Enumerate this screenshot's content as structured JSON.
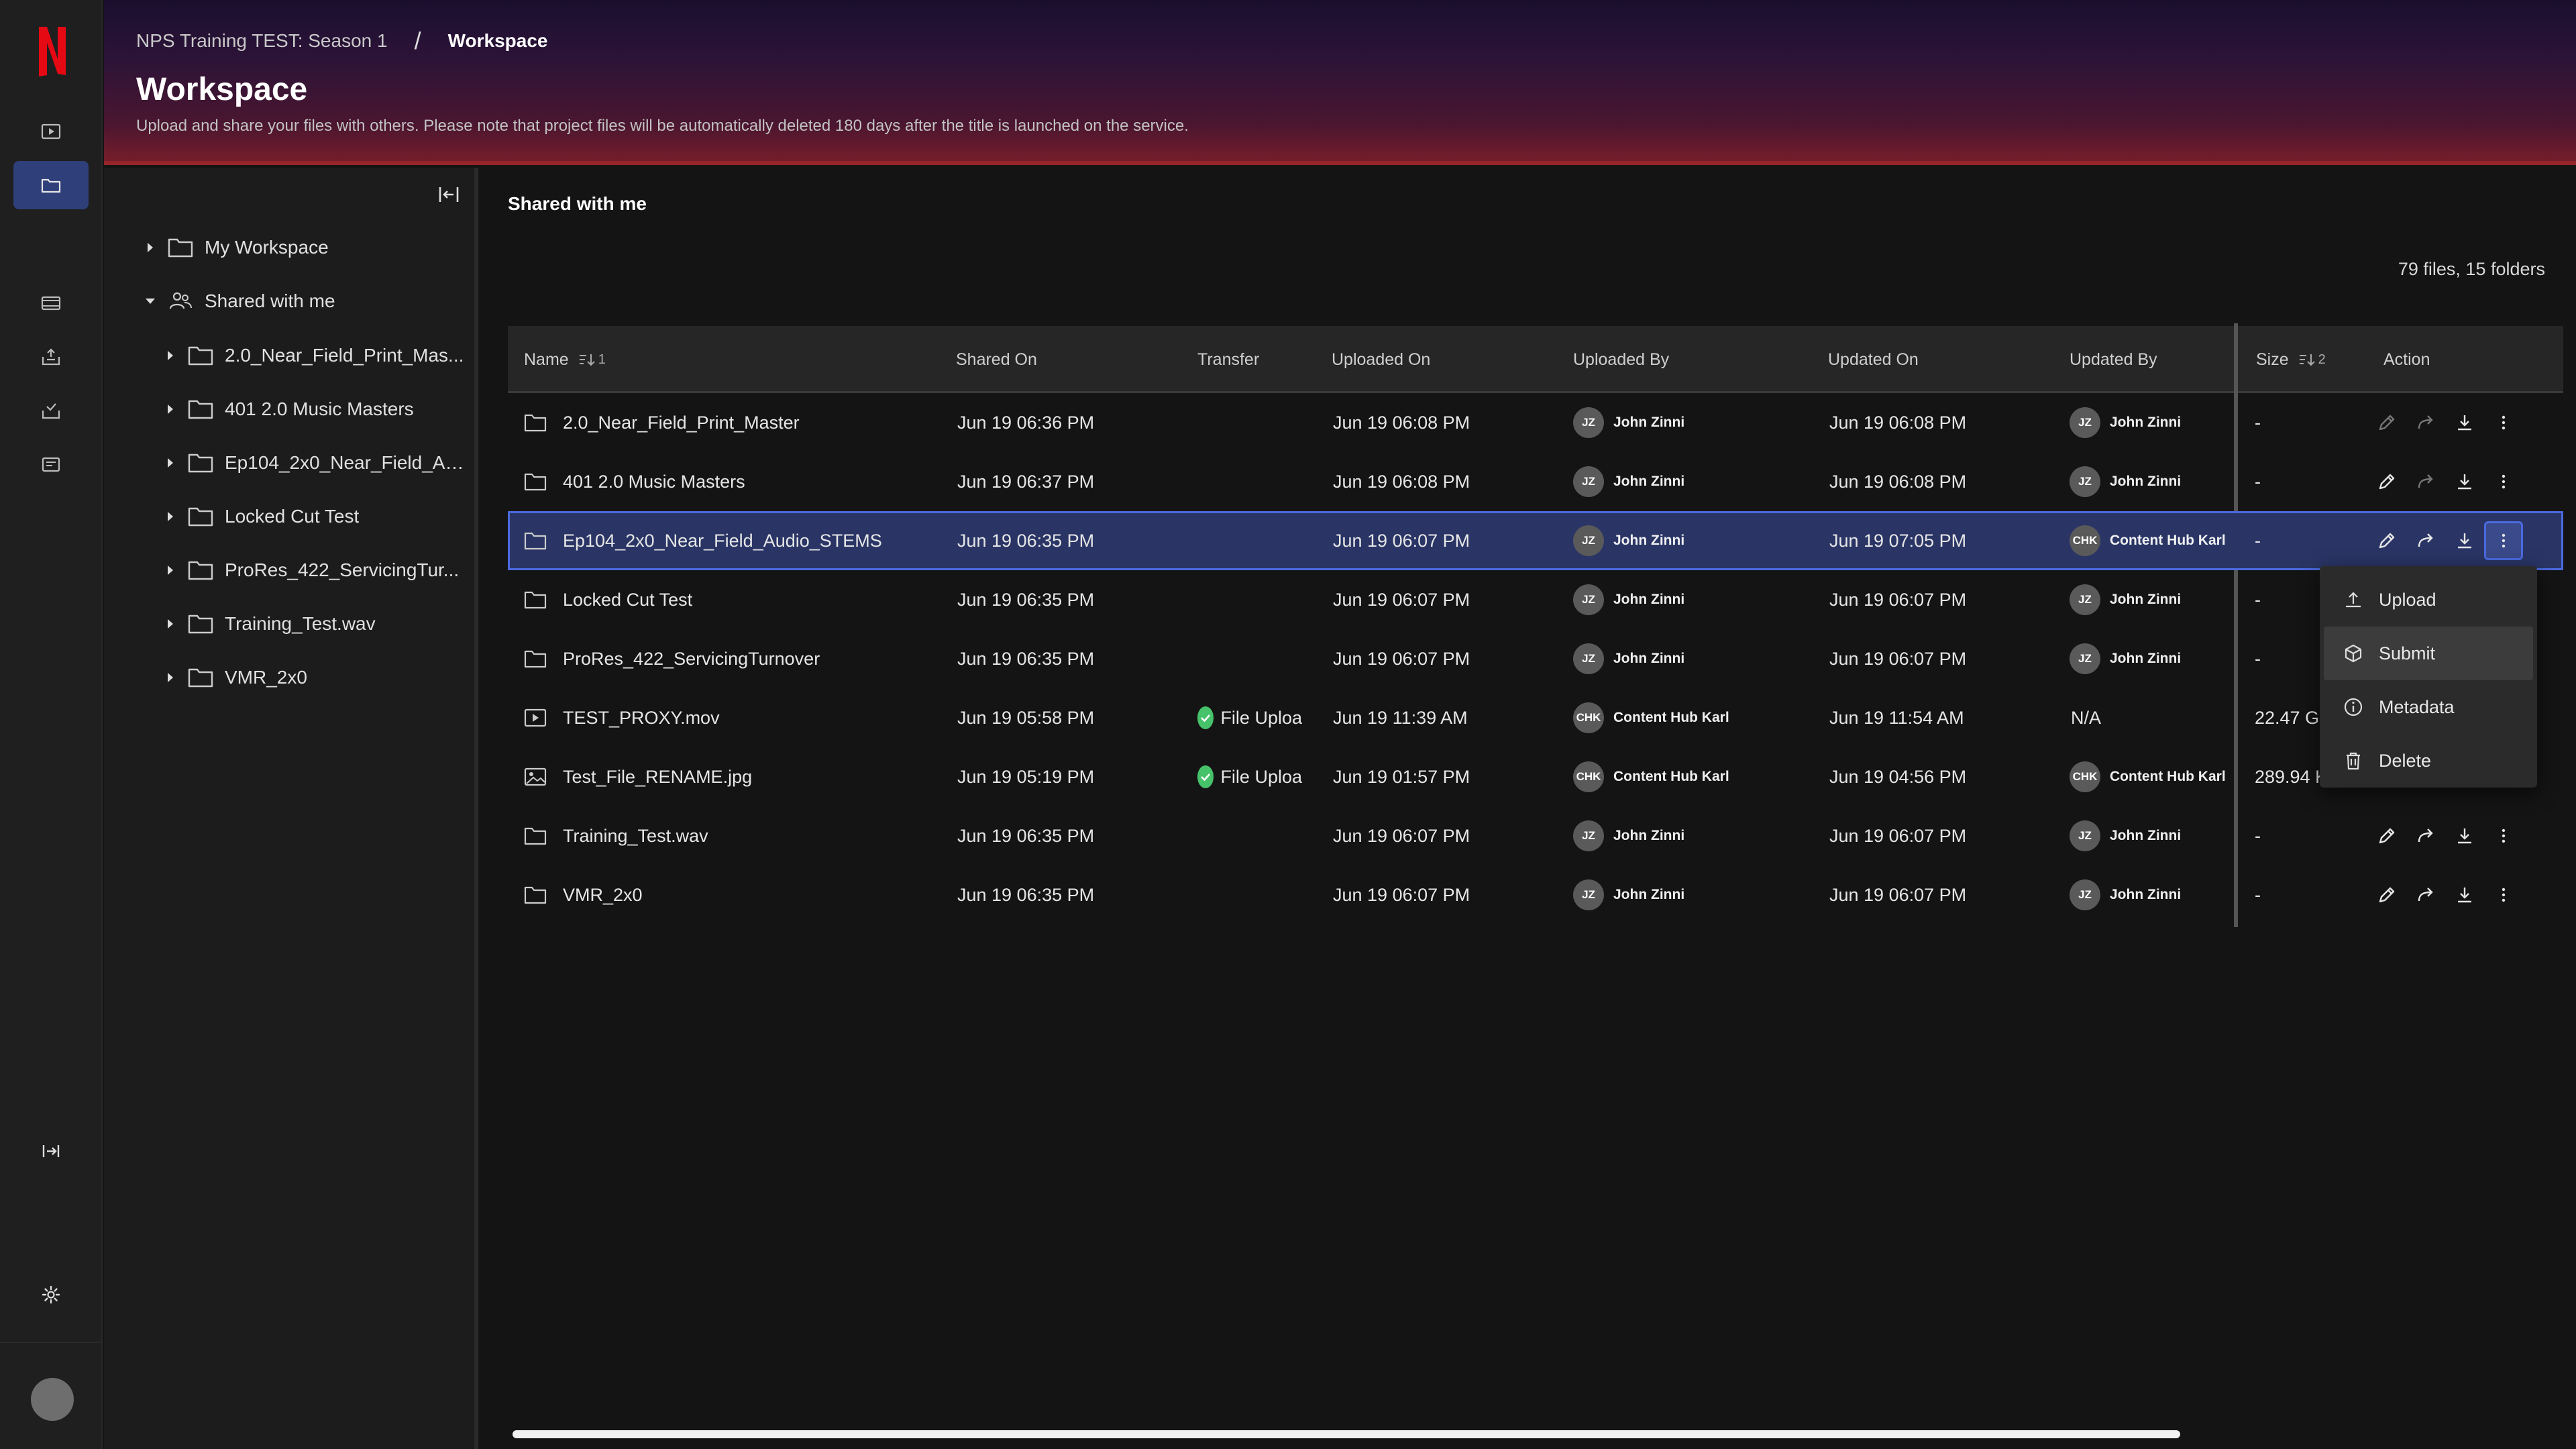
{
  "header": {
    "breadcrumb_project": "NPS Training TEST: Season 1",
    "breadcrumb_separator": "/",
    "breadcrumb_current": "Workspace",
    "title": "Workspace",
    "description": "Upload and share your files with others. Please note that project files will be automatically deleted 180 days after the title is launched on the service."
  },
  "rail": {
    "items": [
      "play-icon",
      "folder-icon",
      "film-icon",
      "upload-tray-icon",
      "checked-tray-icon",
      "inbox-icon"
    ],
    "active": "folder-icon",
    "accent": "#2f3f7a",
    "brand": "#e50914"
  },
  "tree": {
    "my_workspace": "My Workspace",
    "shared_with_me": "Shared with me",
    "children": [
      "2.0_Near_Field_Print_Mas...",
      "401 2.0 Music Masters",
      "Ep104_2x0_Near_Field_Au...",
      "Locked Cut Test",
      "ProRes_422_ServicingTur...",
      "Training_Test.wav",
      "VMR_2x0"
    ]
  },
  "main": {
    "section_title": "Shared with me",
    "count": "79 files, 15 folders",
    "columns": {
      "name": "Name",
      "name_sort": "1",
      "shared_on": "Shared On",
      "transfer": "Transfer",
      "uploaded_on": "Uploaded On",
      "uploaded_by": "Uploaded By",
      "updated_on": "Updated On",
      "updated_by": "Updated By",
      "size": "Size",
      "size_sort": "2",
      "action": "Action"
    },
    "rows": [
      {
        "icon": "folder",
        "name": "2.0_Near_Field_Print_Master",
        "shared_on": "Jun 19 06:36 PM",
        "transfer": "",
        "uploaded_on": "Jun 19 06:08 PM",
        "up_init": "JZ",
        "up_by": "John Zinni",
        "updated_on": "Jun 19 06:08 PM",
        "upd_init": "JZ",
        "upd_by": "John Zinni",
        "size": "-"
      },
      {
        "icon": "folder",
        "name": "401 2.0 Music Masters",
        "shared_on": "Jun 19 06:37 PM",
        "transfer": "",
        "uploaded_on": "Jun 19 06:08 PM",
        "up_init": "JZ",
        "up_by": "John Zinni",
        "updated_on": "Jun 19 06:08 PM",
        "upd_init": "JZ",
        "upd_by": "John Zinni",
        "size": "-"
      },
      {
        "icon": "folder",
        "name": "Ep104_2x0_Near_Field_Audio_STEMS",
        "shared_on": "Jun 19 06:35 PM",
        "transfer": "",
        "uploaded_on": "Jun 19 06:07 PM",
        "up_init": "JZ",
        "up_by": "John Zinni",
        "updated_on": "Jun 19 07:05 PM",
        "upd_init": "CHK",
        "upd_by": "Content Hub Karl",
        "size": "-"
      },
      {
        "icon": "folder",
        "name": "Locked Cut Test",
        "shared_on": "Jun 19 06:35 PM",
        "transfer": "",
        "uploaded_on": "Jun 19 06:07 PM",
        "up_init": "JZ",
        "up_by": "John Zinni",
        "updated_on": "Jun 19 06:07 PM",
        "upd_init": "JZ",
        "upd_by": "John Zinni",
        "size": "-"
      },
      {
        "icon": "folder",
        "name": "ProRes_422_ServicingTurnover",
        "shared_on": "Jun 19 06:35 PM",
        "transfer": "",
        "uploaded_on": "Jun 19 06:07 PM",
        "up_init": "JZ",
        "up_by": "John Zinni",
        "updated_on": "Jun 19 06:07 PM",
        "upd_init": "JZ",
        "upd_by": "John Zinni",
        "size": "-"
      },
      {
        "icon": "video",
        "name": "TEST_PROXY.mov",
        "shared_on": "Jun 19 05:58 PM",
        "transfer": "File Uploa",
        "uploaded_on": "Jun 19 11:39 AM",
        "up_init": "CHK",
        "up_by": "Content Hub Karl",
        "updated_on": "Jun 19 11:54 AM",
        "upd_init": "",
        "upd_by": "N/A",
        "size": "22.47 GB"
      },
      {
        "icon": "image",
        "name": "Test_File_RENAME.jpg",
        "shared_on": "Jun 19 05:19 PM",
        "transfer": "File Uploa",
        "uploaded_on": "Jun 19 01:57 PM",
        "up_init": "CHK",
        "up_by": "Content Hub Karl",
        "updated_on": "Jun 19 04:56 PM",
        "upd_init": "CHK",
        "upd_by": "Content Hub Karl",
        "size": "289.94 KB"
      },
      {
        "icon": "folder",
        "name": "Training_Test.wav",
        "shared_on": "Jun 19 06:35 PM",
        "transfer": "",
        "uploaded_on": "Jun 19 06:07 PM",
        "up_init": "JZ",
        "up_by": "John Zinni",
        "updated_on": "Jun 19 06:07 PM",
        "upd_init": "JZ",
        "upd_by": "John Zinni",
        "size": "-"
      },
      {
        "icon": "folder",
        "name": "VMR_2x0",
        "shared_on": "Jun 19 06:35 PM",
        "transfer": "",
        "uploaded_on": "Jun 19 06:07 PM",
        "up_init": "JZ",
        "up_by": "John Zinni",
        "updated_on": "Jun 19 06:07 PM",
        "upd_init": "JZ",
        "upd_by": "John Zinni",
        "size": "-"
      }
    ],
    "selected_row": 2
  },
  "menu": {
    "items": [
      "Upload",
      "Submit",
      "Metadata",
      "Delete"
    ],
    "hovered": "Submit"
  },
  "colors": {
    "selection": "#2a3566",
    "selection_border": "#4b6ae0",
    "success": "#46c26a"
  }
}
